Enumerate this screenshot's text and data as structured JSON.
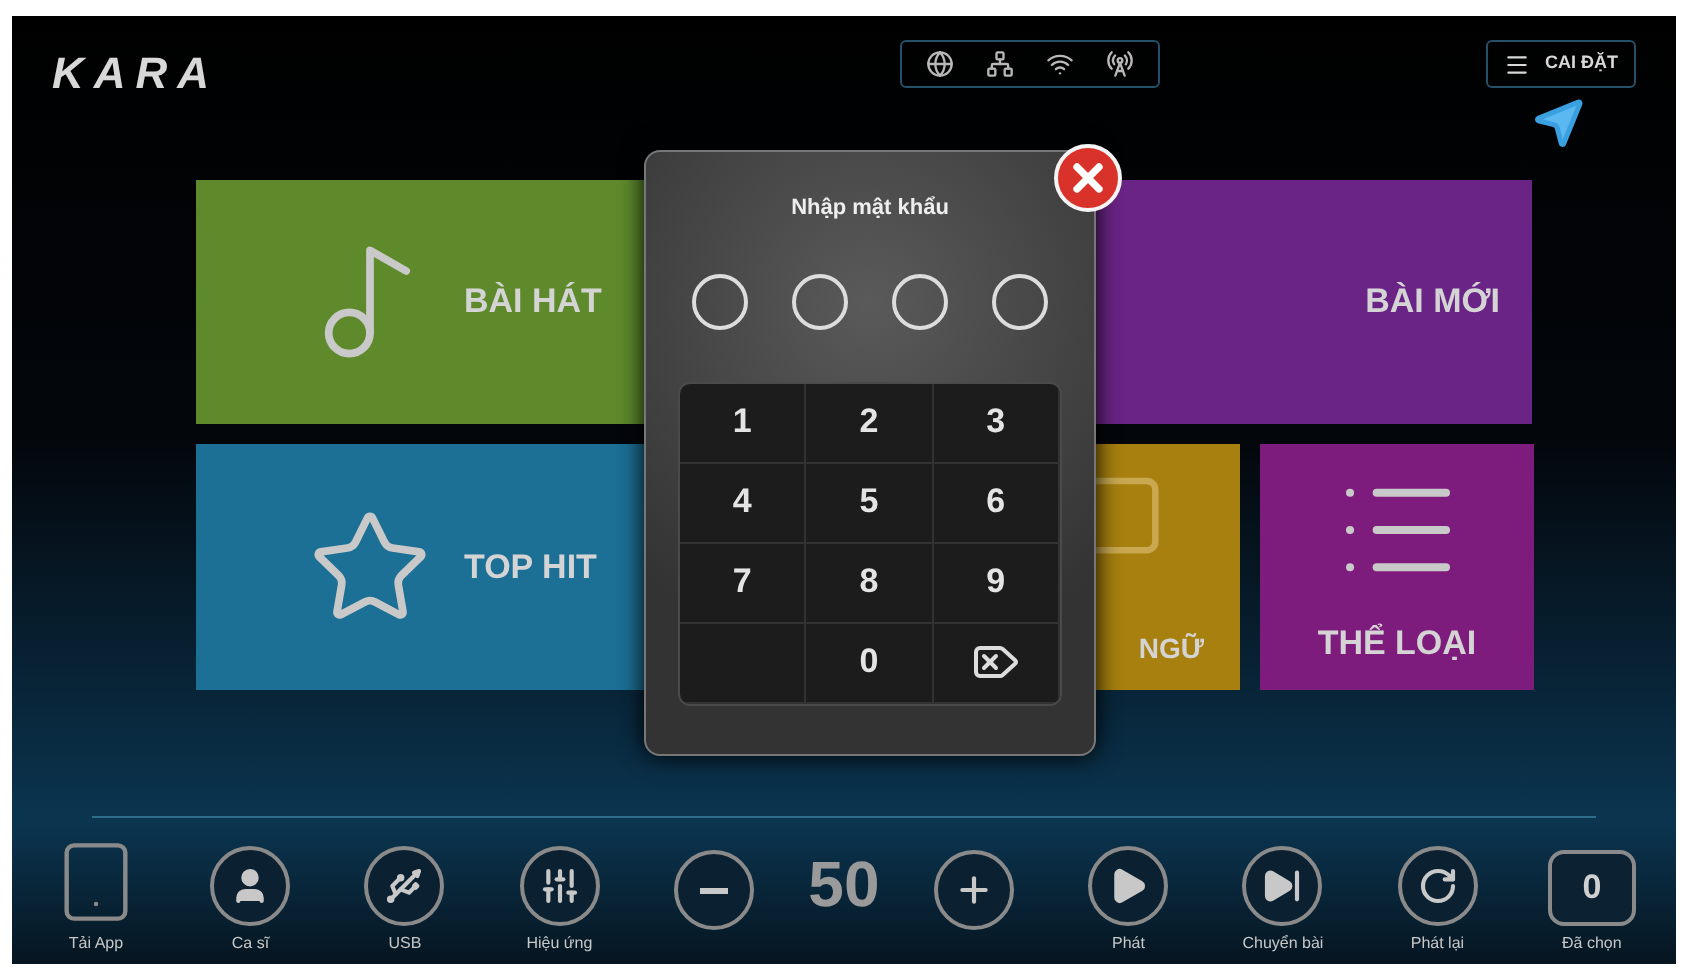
{
  "logo": "KARA",
  "status_icons": [
    {
      "kind": "globe"
    },
    {
      "kind": "network"
    },
    {
      "kind": "wifi"
    },
    {
      "kind": "antenna"
    }
  ],
  "settings_button": "CAI ĐẶT",
  "tiles": [
    {
      "kind": "song",
      "label": "BÀI HÁT",
      "color": "#5e8a2c"
    },
    {
      "kind": "new",
      "label": "BÀI MỚI",
      "color": "#6a2485"
    },
    {
      "kind": "top",
      "label": "TOP HIT",
      "color": "#1c6f95"
    },
    {
      "kind": "language",
      "label": "NGỮ",
      "color": "#a7800f"
    },
    {
      "kind": "genre",
      "label": "THỂ LOẠI",
      "color": "#7e1c7d"
    }
  ],
  "dialog": {
    "title": "Nhập mật khẩu",
    "pin_slots": [
      {
        "filled": false
      },
      {
        "filled": false
      },
      {
        "filled": false
      },
      {
        "filled": false
      }
    ],
    "keys": [
      {
        "kind": "digit",
        "label": "1"
      },
      {
        "kind": "digit",
        "label": "2"
      },
      {
        "kind": "digit",
        "label": "3"
      },
      {
        "kind": "digit",
        "label": "4"
      },
      {
        "kind": "digit",
        "label": "5"
      },
      {
        "kind": "digit",
        "label": "6"
      },
      {
        "kind": "digit",
        "label": "7"
      },
      {
        "kind": "digit",
        "label": "8"
      },
      {
        "kind": "digit",
        "label": "9"
      },
      {
        "kind": "empty"
      },
      {
        "kind": "digit",
        "label": "0"
      },
      {
        "kind": "backspace"
      }
    ]
  },
  "bottom_bar": [
    {
      "kind": "tablet",
      "label": "Tải App"
    },
    {
      "kind": "singer",
      "label": "Ca sĩ"
    },
    {
      "kind": "usb",
      "label": "USB"
    },
    {
      "kind": "effects",
      "label": "Hiệu ứng"
    },
    {
      "kind": "minus"
    },
    {
      "kind": "volume",
      "value": "50"
    },
    {
      "kind": "plus"
    },
    {
      "kind": "play",
      "label": "Phát"
    },
    {
      "kind": "next",
      "label": "Chuyển bài"
    },
    {
      "kind": "replay",
      "label": "Phát lại"
    },
    {
      "kind": "selected",
      "count": "0",
      "label": "Đã chọn"
    }
  ]
}
